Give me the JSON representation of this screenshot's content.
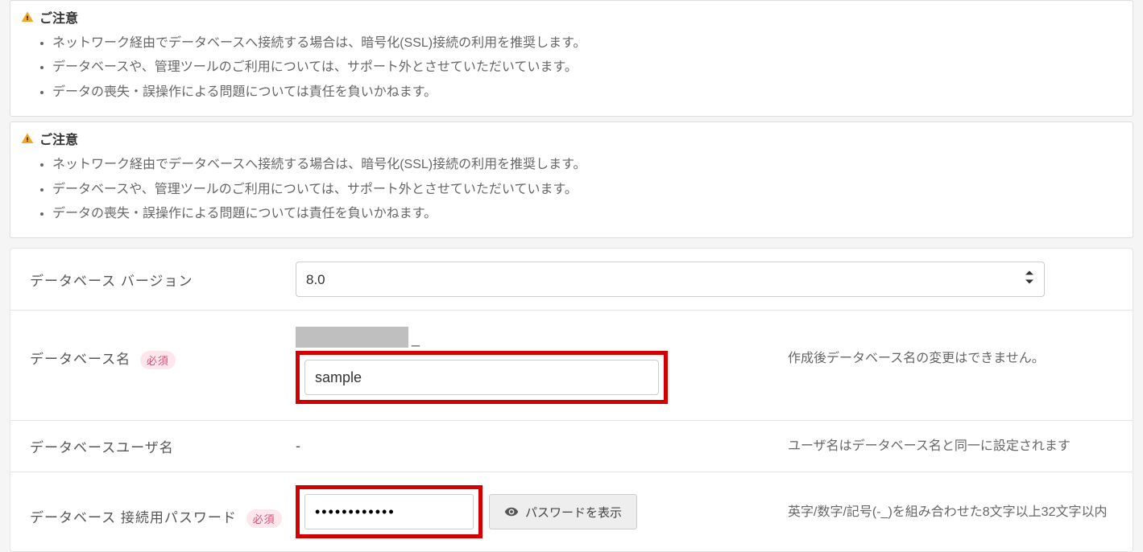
{
  "notices": [
    {
      "title": "ご注意",
      "items": [
        "ネットワーク経由でデータベースへ接続する場合は、暗号化(SSL)接続の利用を推奨します。",
        "データベースや、管理ツールのご利用については、サポート外とさせていただいています。",
        "データの喪失・誤操作による問題については責任を負いかねます。"
      ]
    },
    {
      "title": "ご注意",
      "items": [
        "ネットワーク経由でデータベースへ接続する場合は、暗号化(SSL)接続の利用を推奨します。",
        "データベースや、管理ツールのご利用については、サポート外とさせていただいています。",
        "データの喪失・誤操作による問題については責任を負いかねます。"
      ]
    }
  ],
  "form": {
    "required_badge": "必須",
    "version": {
      "label": "データベース バージョン",
      "value": "8.0"
    },
    "dbname": {
      "label": "データベース名",
      "prefix_separator": "_",
      "value": "sample",
      "helper": "作成後データベース名の変更はできません。"
    },
    "dbuser": {
      "label": "データベースユーザ名",
      "value": "-",
      "helper": "ユーザ名はデータベース名と同一に設定されます"
    },
    "dbpassword": {
      "label": "データベース 接続用パスワード",
      "value": "••••••••••••",
      "show_button": "パスワードを表示",
      "helper": "英字/数字/記号(-_)を組み合わせた8文字以上32文字以内"
    }
  }
}
